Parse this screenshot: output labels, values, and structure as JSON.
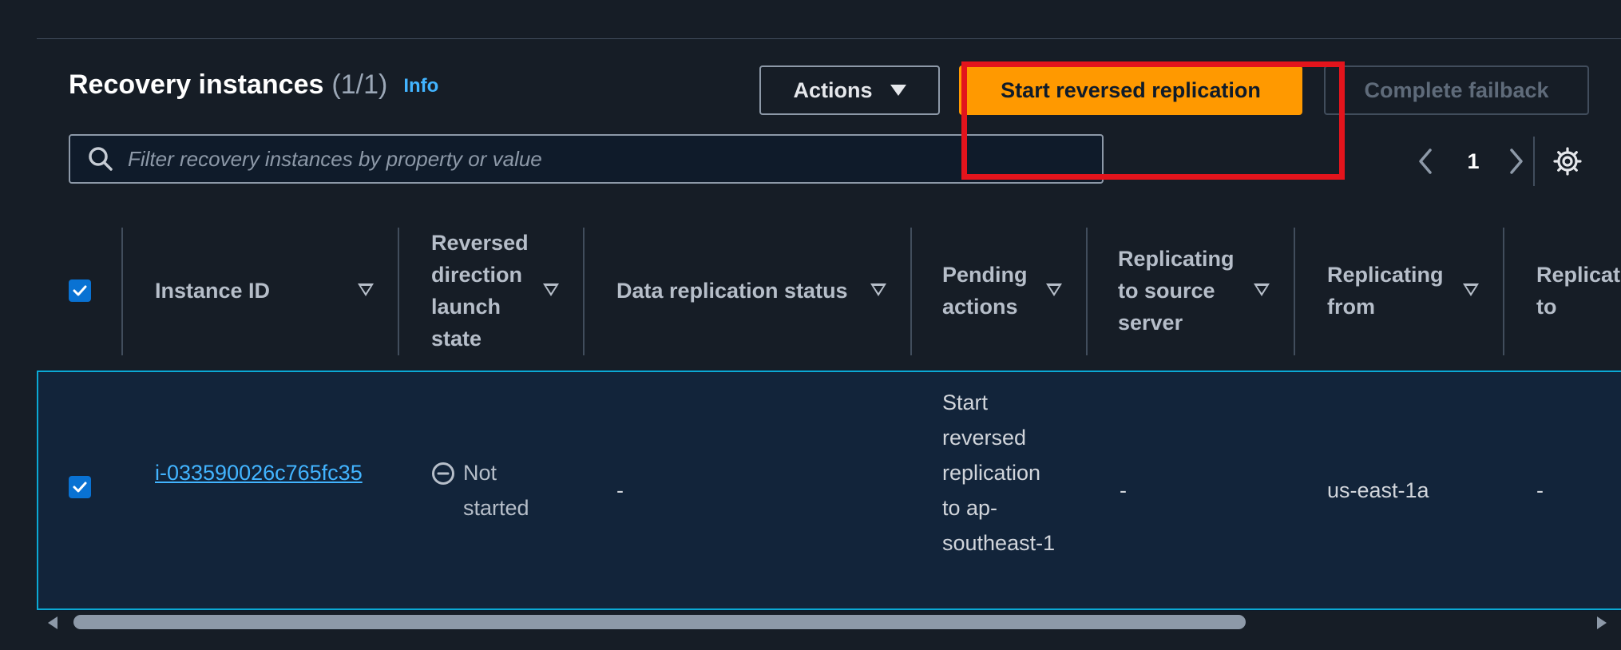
{
  "header": {
    "title": "Recovery instances",
    "count": "(1/1)",
    "info_label": "Info"
  },
  "toolbar": {
    "actions_label": "Actions",
    "start_reversed_label": "Start reversed replication",
    "complete_failback_label": "Complete failback"
  },
  "search": {
    "placeholder": "Filter recovery instances by property or value"
  },
  "pagination": {
    "current_page": "1"
  },
  "table": {
    "columns": [
      {
        "label": "Instance ID"
      },
      {
        "label": "Reversed direction launch state"
      },
      {
        "label": "Data replication status"
      },
      {
        "label": "Pending actions"
      },
      {
        "label": "Replicating to source server"
      },
      {
        "label": "Replicating from"
      },
      {
        "label": "Replicat to"
      }
    ],
    "rows": [
      {
        "selected": true,
        "instance_id": "i-033590026c765fc35",
        "launch_state": "Not started",
        "data_replication_status": "-",
        "pending_actions": "Start reversed replication to ap-southeast-1",
        "replicating_to_source": "-",
        "replicating_from": "us-east-1a",
        "replicating_to": "-"
      }
    ]
  },
  "icons": {
    "search": "search-icon",
    "settings": "gear-icon",
    "prev": "chevron-left-icon",
    "next": "chevron-right-icon",
    "status": "not-started-icon",
    "actions_caret": "caret-down-icon"
  },
  "colors": {
    "primary_button": "#ff9900",
    "link": "#42b4ff",
    "selected_row_border": "#0ba9d4",
    "highlight_annotation": "#e3141c",
    "checkbox": "#0972d3"
  }
}
